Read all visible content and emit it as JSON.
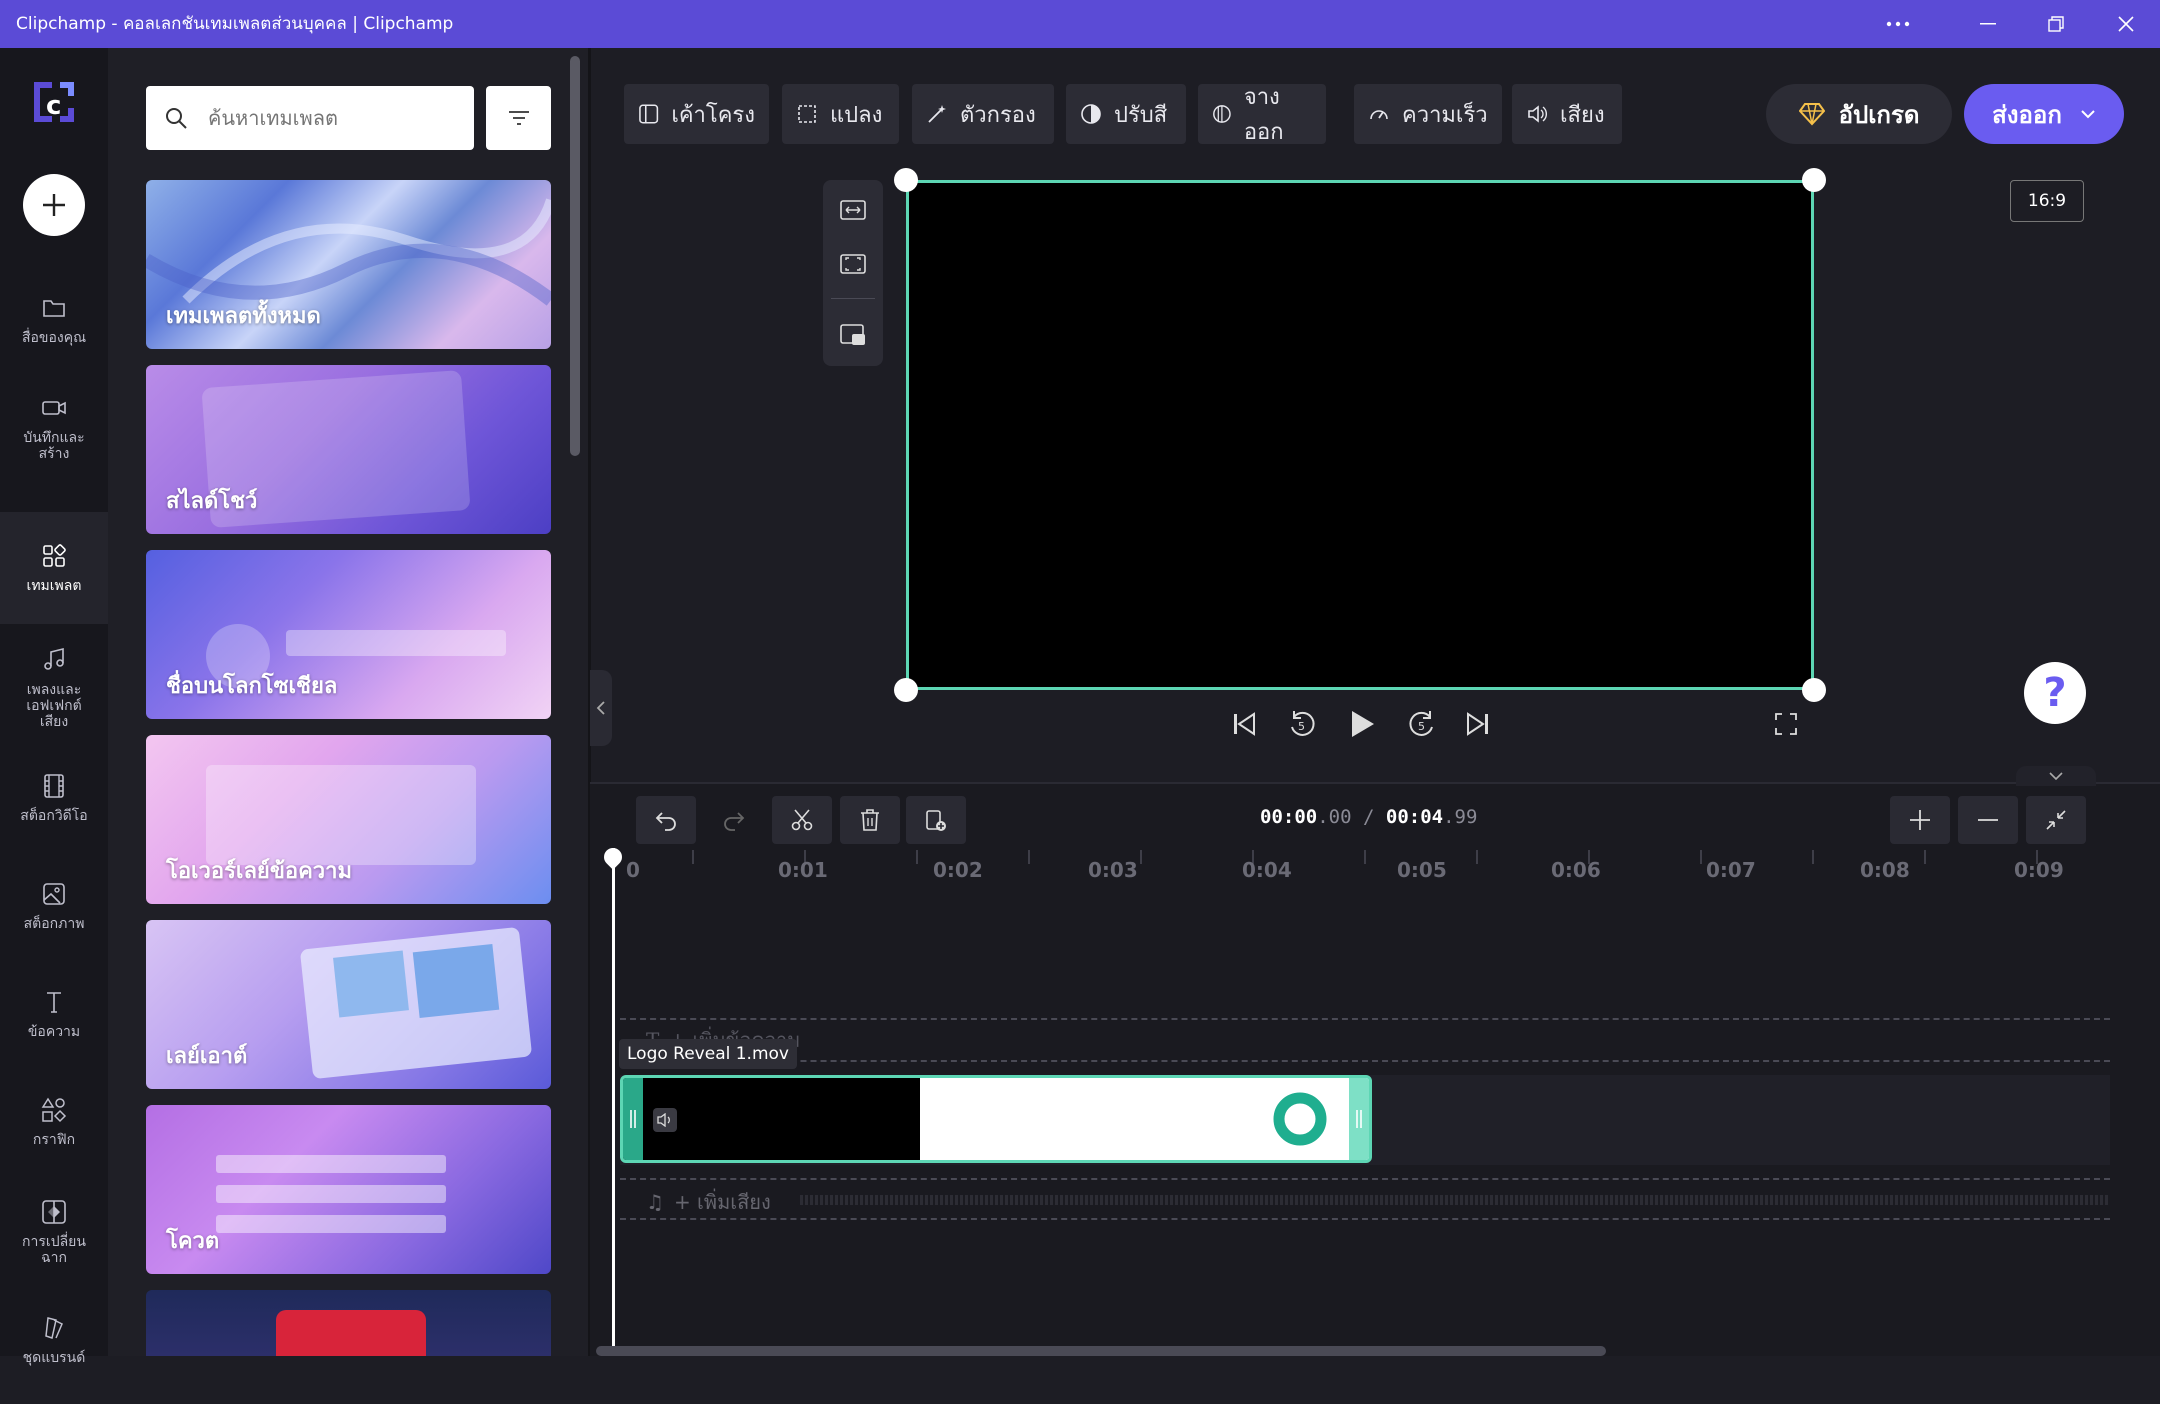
{
  "window": {
    "title": "Clipchamp - คอลเลกชันเทมเพลตส่วนบุคคล | Clipchamp"
  },
  "nav": {
    "items": [
      {
        "label": "สื่อของคุณ",
        "icon": "folder-icon"
      },
      {
        "label": "บันทึกและสร้าง",
        "icon": "camera-icon"
      },
      {
        "label": "เทมเพลต",
        "icon": "templates-icon"
      },
      {
        "label": "เพลงและเอฟเฟกต์เสียง",
        "icon": "music-icon"
      },
      {
        "label": "สต็อกวิดีโอ",
        "icon": "film-icon"
      },
      {
        "label": "สต็อกภาพ",
        "icon": "image-icon"
      },
      {
        "label": "ข้อความ",
        "icon": "text-icon"
      },
      {
        "label": "กราฟิก",
        "icon": "shapes-icon"
      },
      {
        "label": "การเปลี่ยนฉาก",
        "icon": "transition-icon"
      },
      {
        "label": "ชุดแบรนด์",
        "icon": "brand-icon"
      }
    ]
  },
  "panel": {
    "search_placeholder": "ค้นหาเทมเพลต",
    "cards": [
      {
        "label": "เทมเพลตทั้งหมด"
      },
      {
        "label": "สไลด์โชว์"
      },
      {
        "label": "ชื่อบนโลกโซเชียล"
      },
      {
        "label": "โอเวอร์เลย์ข้อความ"
      },
      {
        "label": "เลย์เอาต์"
      },
      {
        "label": "โควต"
      }
    ]
  },
  "toolbar": {
    "items": [
      {
        "label": "เค้าโครง",
        "icon": "layout-icon"
      },
      {
        "label": "แปลง",
        "icon": "transform-icon"
      },
      {
        "label": "ตัวกรอง",
        "icon": "filter-wand-icon"
      },
      {
        "label": "ปรับสี",
        "icon": "adjust-color-icon"
      },
      {
        "label": "จางออก",
        "icon": "fade-icon"
      },
      {
        "label": "ความเร็ว",
        "icon": "speed-icon"
      },
      {
        "label": "เสียง",
        "icon": "volume-icon"
      }
    ],
    "upgrade_label": "อัปเกรด",
    "export_label": "ส่งออก"
  },
  "preview": {
    "aspect_ratio": "16:9",
    "help": "?",
    "skip_back_seconds": "5",
    "skip_forward_seconds": "5"
  },
  "timeline": {
    "current_time": "00:00",
    "current_frac": ".00",
    "separator": "/",
    "total_time": "00:04",
    "total_frac": ".99",
    "ruler_labels": [
      "0",
      "0:01",
      "0:02",
      "0:03",
      "0:04",
      "0:05",
      "0:06",
      "0:07",
      "0:08",
      "0:09"
    ],
    "text_track_label": "+ เพิ่มข้อความ",
    "clip_name": "Logo Reveal 1.mov",
    "audio_track_label": "+ เพิ่มเสียง"
  },
  "colors": {
    "accent": "#6a5cf0",
    "titlebar": "#5b4bd6",
    "selection": "#5dd6b4"
  }
}
